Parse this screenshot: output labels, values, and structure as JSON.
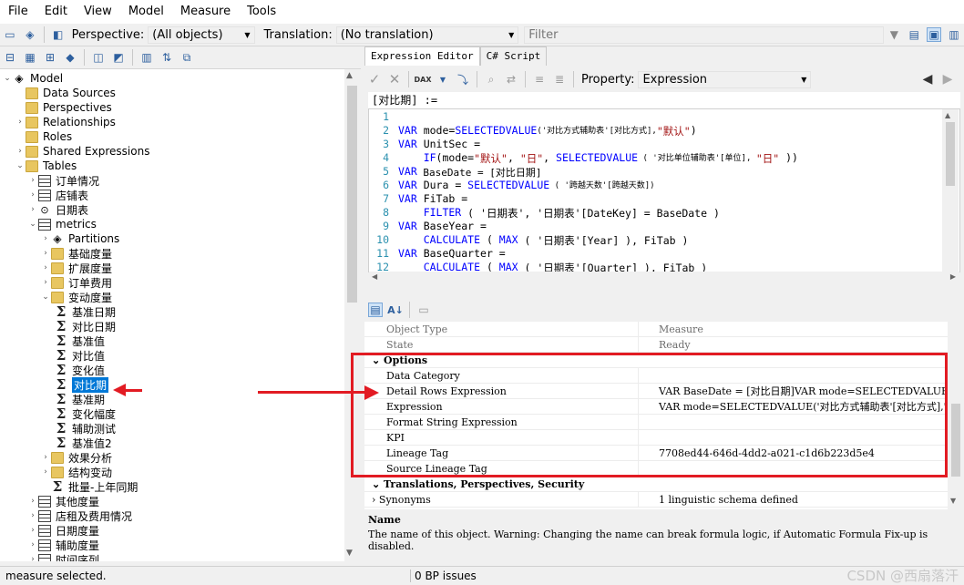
{
  "menu": [
    "File",
    "Edit",
    "View",
    "Model",
    "Measure",
    "Tools"
  ],
  "toolbar": {
    "perspective_label": "Perspective:",
    "perspective_value": "(All objects)",
    "translation_label": "Translation:",
    "translation_value": "(No translation)",
    "filter_placeholder": "Filter"
  },
  "tree": {
    "model": "Model",
    "data_sources": "Data Sources",
    "perspectives": "Perspectives",
    "relationships": "Relationships",
    "roles": "Roles",
    "shared_expressions": "Shared Expressions",
    "tables": "Tables",
    "t_orders": "订单情况",
    "t_shops": "店铺表",
    "t_dates": "日期表",
    "t_metrics": "metrics",
    "partitions": "Partitions",
    "f_base": "基础度量",
    "f_ext": "扩展度量",
    "f_order_fee": "订单费用",
    "f_change": "变动度量",
    "m1": "基准日期",
    "m2": "对比日期",
    "m3": "基准值",
    "m4": "对比值",
    "m5": "变化值",
    "m6": "对比期",
    "m7": "基准期",
    "m8": "变化幅度",
    "m9": "辅助测试",
    "m10": "基准值2",
    "f_effect": "效果分析",
    "f_struct": "结构变动",
    "m_batch": "批量-上年同期",
    "t_other": "其他度量",
    "t_rent": "店租及费用情况",
    "t_datemeas": "日期度量",
    "t_aux": "辅助度量",
    "t_series": "时间序列"
  },
  "tabs": [
    "Expression Editor",
    "C# Script"
  ],
  "editor": {
    "property_label": "Property:",
    "property_value": "Expression",
    "name_line": "[对比期] :="
  },
  "code": {
    "l1": "1",
    "l2": "2",
    "l3": "3",
    "l4": "4",
    "l5": "5",
    "l6": "6",
    "l7": "7",
    "l8": "8",
    "l9": "9",
    "l10": "10",
    "l11": "11",
    "l12": "12",
    "c2a": "VAR",
    "c2b": " mode=",
    "c2c": "SELECTEDVALUE",
    "c2d": "('对比方式辅助表'[对比方式],",
    "c2e": "\"默认\"",
    "c2f": ")",
    "c3a": "VAR",
    "c3b": " UnitSec =",
    "c4a": "    IF",
    "c4b": "(mode=",
    "c4c": "\"默认\"",
    "c4d": ", ",
    "c4e": "\"日\"",
    "c4f": ", ",
    "c4g": "SELECTEDVALUE",
    "c4h": " ( '对比单位辅助表'[单位], ",
    "c4i": "\"日\"",
    "c4j": " ))",
    "c5a": "VAR",
    "c5b": " BaseDate = [对比日期]",
    "c6a": "VAR",
    "c6b": " Dura = ",
    "c6c": "SELECTEDVALUE",
    "c6d": " ( '跨越天数'[跨越天数])",
    "c7a": "VAR",
    "c7b": " FiTab =",
    "c8a": "    FILTER",
    "c8b": " ( '日期表', '日期表'[DateKey] = BaseDate )",
    "c9a": "VAR",
    "c9b": " BaseYear =",
    "c10a": "    CALCULATE",
    "c10b": " ( ",
    "c10c": "MAX",
    "c10d": " ( '日期表'[Year] ), FiTab )",
    "c11a": "VAR",
    "c11b": " BaseQuarter =",
    "c12a": "    CALCULATE",
    "c12b": " ( ",
    "c12c": "MAX",
    "c12d": " ( '日期表'[Quarter] ), FiTab )"
  },
  "props": {
    "object_type": "Object Type",
    "object_type_val": "Measure",
    "state": "State",
    "state_val": "Ready",
    "options": "Options",
    "data_category": "Data Category",
    "detail_rows": "Detail Rows Expression",
    "detail_rows_val": "VAR BaseDate = [对比日期]VAR mode=SELECTEDVALUE('对比",
    "expression": "Expression",
    "expression_val": "VAR mode=SELECTEDVALUE('对比方式辅助表'[对比方式],\"默",
    "format_string": "Format String Expression",
    "kpi": "KPI",
    "lineage": "Lineage Tag",
    "lineage_val": "7708ed44-646d-4dd2-a021-c1d6b223d5e4",
    "source_lineage": "Source Lineage Tag",
    "translations": "Translations, Perspectives, Security",
    "synonyms": "Synonyms",
    "synonyms_val": "1 linguistic schema defined"
  },
  "description": {
    "title": "Name",
    "text": "The name of this object. Warning: Changing the name can break formula logic, if Automatic Formula Fix-up is disabled."
  },
  "status": {
    "left": "measure selected.",
    "issues": "0 BP issues",
    "watermark": "CSDN @西扇落汗"
  },
  "colors": {
    "accent": "#0078d7",
    "annotation": "#e21b23"
  }
}
